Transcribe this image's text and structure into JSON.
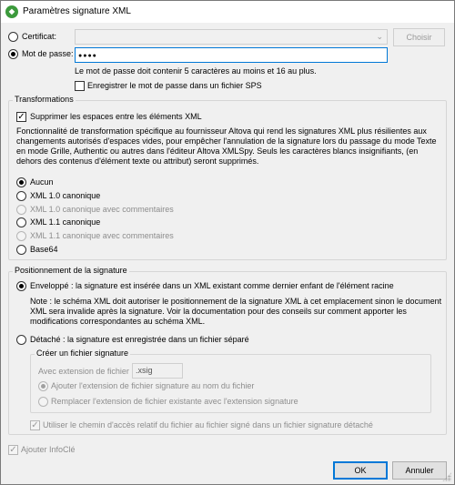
{
  "window": {
    "title": "Paramètres signature XML"
  },
  "auth": {
    "certificate_label": "Certificat:",
    "choose_label": "Choisir",
    "password_label": "Mot de passe:",
    "password_value": "●●●●",
    "hint": "Le mot de passe doit contenir 5 caractères au moins et 16 au plus.",
    "save_in_sps_label": "Enregistrer le mot de passe dans un fichier SPS"
  },
  "transformations": {
    "legend": "Transformations",
    "remove_spaces_label": "Supprimer les espaces entre les éléments XML",
    "description": "Fonctionnalité de transformation spécifique au fournisseur Altova qui rend les signatures XML plus résilientes aux changements autorisés d'espaces vides, pour empêcher l'annulation de la signature lors du passage du mode Texte en mode Grille, Authentic ou autres dans l'éditeur Altova XMLSpy. Seuls les caractères blancs insignifiants, (en dehors des contenus d'élément texte ou attribut) seront supprimés.",
    "options": [
      {
        "label": "Aucun",
        "checked": true,
        "enabled": true
      },
      {
        "label": "XML 1.0 canonique",
        "checked": false,
        "enabled": true
      },
      {
        "label": "XML 1.0 canonique avec commentaires",
        "checked": false,
        "enabled": false
      },
      {
        "label": "XML 1.1 canonique",
        "checked": false,
        "enabled": true
      },
      {
        "label": "XML 1.1 canonique avec commentaires",
        "checked": false,
        "enabled": false
      },
      {
        "label": "Base64",
        "checked": false,
        "enabled": true
      }
    ]
  },
  "positioning": {
    "legend": "Positionnement de la signature",
    "enveloped_label": "Enveloppé : la signature est insérée dans un XML existant comme dernier enfant de l'élément racine",
    "note": "Note : le schéma XML doit autoriser le positionnement de la signature XML à cet emplacement sinon le document XML sera invalide après la signature. Voir la documentation pour des conseils sur comment apporter les modifications correspondantes au schéma XML.",
    "detached_label": "Détaché : la signature est enregistrée dans un fichier séparé",
    "create_file": {
      "legend": "Créer un fichier signature",
      "extension_label": "Avec extension de fichier",
      "extension_value": ".xsig",
      "append_label": "Ajouter l'extension de fichier signature au nom du fichier",
      "replace_label": "Remplacer l'extension de fichier existante avec l'extension signature"
    },
    "relative_path_label": "Utiliser le chemin d'accès relatif du fichier au fichier signé dans un fichier signature détaché"
  },
  "footer": {
    "add_keyinfo_label": "Ajouter InfoClé",
    "ok_label": "OK",
    "cancel_label": "Annuler"
  }
}
